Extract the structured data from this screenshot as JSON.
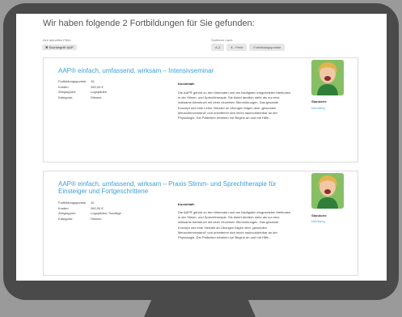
{
  "header": {
    "results_heading": "Wir haben folgende 2 Fortbildungen für Sie gefunden:",
    "filters_label": "Ihre aktuellen Filter:",
    "active_filter": "Suchbegriff: AAP",
    "sort_label": "Sortieren nach:",
    "sort_options": [
      "A-Z",
      "€ - Preis",
      "Fortbildungspunkte"
    ]
  },
  "courses": [
    {
      "title": "AAP® einfach, umfassend, wirksam – Intensivseminar",
      "facts": [
        {
          "key": "Fortbildungspunkte:",
          "value": "15"
        },
        {
          "key": "Kosten:",
          "value": "260,00 €"
        },
        {
          "key": "Zielgruppen:",
          "value": "Logopäden"
        },
        {
          "key": "Kategorie:",
          "value": "Stimme"
        }
      ],
      "short_label": "Kurzinhalt:",
      "short_text": "Die AAP® gehört zu den führenden und am häufigsten eingesetzten Methoden in der Stimm- und Sprechtherapie. Sie bietet deutlich mehr als nur eine wirksame Atembuch mit einer einzelnen Stimmübungen. Das gesamte Konzept und eine Lehre Vielzahl an Übungen folgen dem „gesunden Menschenverstand“ und orientieren sich leicht nachvollziehbar an der Physiologie. Die Patienten erfahren vor Beginn an und mit Hilfe...",
      "location_label": "Standorte",
      "location": "Nürnberg"
    },
    {
      "title": "AAP® einfach, umfassend, wirksam – Praxis Stimm- und Sprechtherapie für Einsteiger und Fortgeschrittene",
      "facts": [
        {
          "key": "Fortbildungspunkte:",
          "value": "10"
        },
        {
          "key": "Kosten:",
          "value": "260,00 €"
        },
        {
          "key": "Zielgruppen:",
          "value": "Logopäden, Sonstige"
        },
        {
          "key": "Kategorie:",
          "value": "Stimme"
        }
      ],
      "short_label": "Kurzinhalt:",
      "short_text": "Die AAP® gehört zu den führenden und am häufigsten eingesetzten Methoden in der Stimm- und Sprechtherapie. Sie bietet deutlich mehr als nur eine wirksame Atembuch mit einer einzelnen Stimmübungen. Das gesamte Konzept und eine Vielzahl an Übungen folgen dem „gesunden Menschenverstand“ und orientieren sich leicht nachvollziehbar an der Physiologie. Die Patienten erfahren vor Beginn an und mit Hilfe...",
      "location_label": "Standorte",
      "location": "Nürnberg"
    }
  ],
  "icons": {
    "filter_remove": "close-icon",
    "photo": "person-photo"
  },
  "colors": {
    "accent": "#3b9fd8",
    "bezel": "#4a4a4a",
    "background": "#9a9a9a"
  }
}
